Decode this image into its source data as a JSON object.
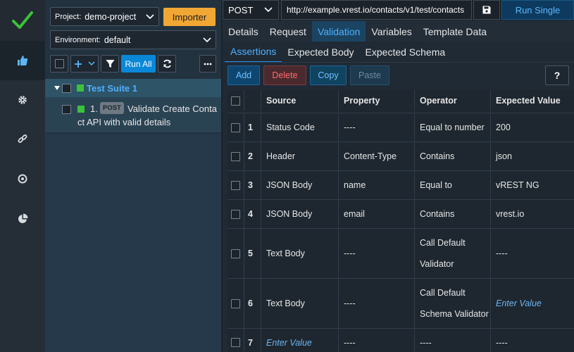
{
  "tree": {
    "project_label": "Project:",
    "project_value": "demo-project",
    "importer_label": "Importer",
    "environment_label": "Environment:",
    "environment_value": "default",
    "run_all_label": "Run All",
    "suite_name": "Test Suite 1",
    "testcase": {
      "index": "1.",
      "method": "POST",
      "line1": "Validate Create Conta",
      "line2": "ct API with valid details"
    }
  },
  "request": {
    "method": "POST",
    "url": "http://example.vrest.io/contacts/v1/test/contacts",
    "run_single_label": "Run Single"
  },
  "tabs": [
    {
      "label": "Details"
    },
    {
      "label": "Request"
    },
    {
      "label": "Validation"
    },
    {
      "label": "Variables"
    },
    {
      "label": "Template Data"
    }
  ],
  "subtabs": [
    {
      "label": "Assertions"
    },
    {
      "label": "Expected Body"
    },
    {
      "label": "Expected Schema"
    }
  ],
  "actions": {
    "add": "Add",
    "delete": "Delete",
    "copy": "Copy",
    "paste": "Paste",
    "help": "?"
  },
  "table": {
    "headers": {
      "source": "Source",
      "property": "Property",
      "operator": "Operator",
      "expected": "Expected Value"
    },
    "rows": [
      {
        "n": "1",
        "source": "Status Code",
        "property": "----",
        "operator": "Equal to number",
        "expected": "200"
      },
      {
        "n": "2",
        "source": "Header",
        "property": "Content-Type",
        "operator": "Contains",
        "expected": "json"
      },
      {
        "n": "3",
        "source": "JSON Body",
        "property": "name",
        "operator": "Equal to",
        "expected": "vREST NG"
      },
      {
        "n": "4",
        "source": "JSON Body",
        "property": "email",
        "operator": "Contains",
        "expected": "vrest.io"
      },
      {
        "n": "5",
        "source": "Text Body",
        "property": "----",
        "operator": "Call Default Validator",
        "expected": "----"
      },
      {
        "n": "6",
        "source": "Text Body",
        "property": "----",
        "operator": "Call Default Schema Validator",
        "expected": "Enter Value"
      },
      {
        "n": "7",
        "source": "Enter Value",
        "property": "----",
        "operator": "----",
        "expected": "----"
      }
    ]
  },
  "colors": {
    "accent": "#0a88d8",
    "importer": "#f0a733",
    "delete": "#e05a5a",
    "placeholder": "#6cb4f0"
  }
}
